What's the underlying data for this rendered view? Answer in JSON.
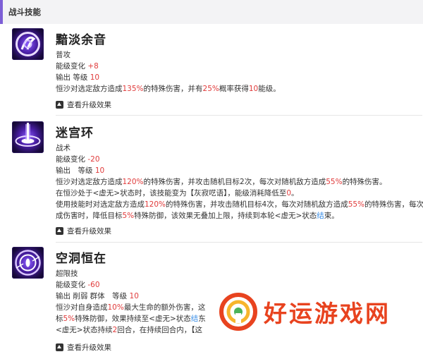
{
  "section": {
    "title": "战斗技能",
    "accent": "#7d5fd6"
  },
  "skills": [
    {
      "name": "黯淡余音",
      "type": "普攻",
      "energy_label": "能级变化",
      "energy_value": "+8",
      "level_prefix": "输出 等级",
      "level_value": "10",
      "desc": [
        [
          "恒沙对选定敌方造成",
          "135%",
          "的特殊伤害，并有",
          "25%",
          "概率获得",
          "10",
          "能级。"
        ]
      ],
      "upgrade_label": "查看升级效果"
    },
    {
      "name": "迷宫环",
      "type": "战术",
      "energy_label": "能级变化",
      "energy_value": "-20",
      "level_prefix": "输出　等级",
      "level_value": "10",
      "desc": [
        [
          "恒沙对选定敌方造成",
          "120%",
          "的特殊伤害，并攻击随机目标2次，每次对随机敌方造成",
          "55%",
          "的特殊伤害。"
        ],
        [
          "在恒沙处于<虚无>状态时，该技能变为【灰寂呓语】，能级消耗降低至",
          "0",
          "。"
        ],
        [
          "使用技能时对选定敌方造成",
          "120%",
          "的特殊伤害，并攻击随机目标4次，每次对随机敌方造成",
          "55%",
          "的特殊伤害，每次造"
        ],
        [
          "成伤害时，降低目标",
          "5%",
          "特殊防御，该效果无叠加上限，持续到本轮<虚无>状态",
          "结",
          "束。"
        ]
      ],
      "upgrade_label": "查看升级效果"
    },
    {
      "name": "空洞恒在",
      "type": "超限技",
      "energy_label": "能级变化",
      "energy_value": "-60",
      "level_prefix": "输出 削弱 群体　等级",
      "level_value": "10",
      "desc": [
        [
          "恒沙对自身造成",
          "10%",
          "最大生命的额外伤害，这"
        ],
        [
          "标",
          "5%",
          "特殊防御，效果持续至<虚无>状态",
          "结",
          "东"
        ],
        [
          "<虚无>状态持续",
          "2",
          "回合，在持续回合内，【这"
        ]
      ],
      "upgrade_label": "查看升级效果"
    }
  ],
  "watermark": {
    "text": "好运游戏网"
  }
}
